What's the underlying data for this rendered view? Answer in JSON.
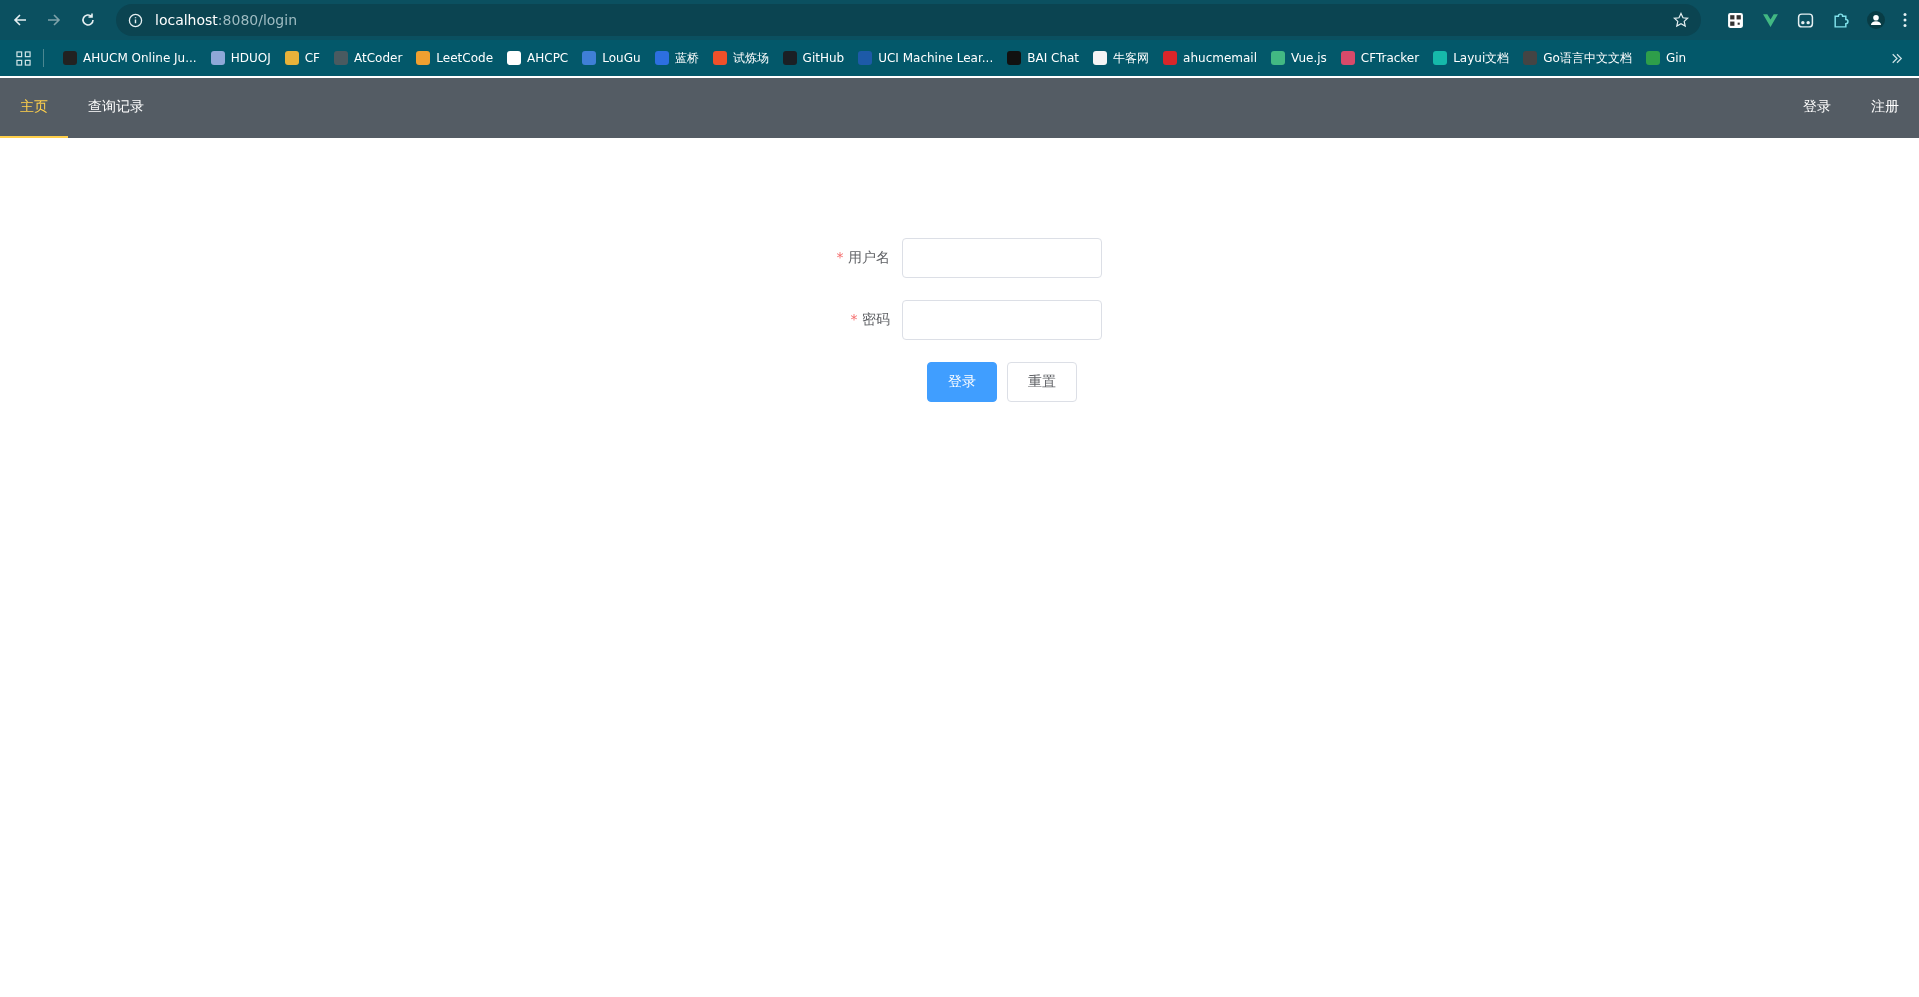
{
  "browser": {
    "address": {
      "host": "localhost",
      "path": ":8080/login"
    },
    "bookmarks": [
      {
        "label": "AHUCM Online Ju...",
        "color": "#222222"
      },
      {
        "label": "HDUOJ",
        "color": "#8fa8d8"
      },
      {
        "label": "CF",
        "color": "#e8b23a"
      },
      {
        "label": "AtCoder",
        "color": "#4a5a60"
      },
      {
        "label": "LeetCode",
        "color": "#f0a030"
      },
      {
        "label": "AHCPC",
        "color": "#ffffff"
      },
      {
        "label": "LouGu",
        "color": "#3f7fd6"
      },
      {
        "label": "蓝桥",
        "color": "#2d6fe0"
      },
      {
        "label": "试炼场",
        "color": "#f0502a"
      },
      {
        "label": "GitHub",
        "color": "#1b1f24"
      },
      {
        "label": "UCI Machine Lear...",
        "color": "#1d5aa8"
      },
      {
        "label": "BAI Chat",
        "color": "#111111"
      },
      {
        "label": "牛客网",
        "color": "#f5f5f5"
      },
      {
        "label": "ahucmemail",
        "color": "#d8262a"
      },
      {
        "label": "Vue.js",
        "color": "#42b883"
      },
      {
        "label": "CFTracker",
        "color": "#d84a6a"
      },
      {
        "label": "Layui文档",
        "color": "#16baaa"
      },
      {
        "label": "Go语言中文文档",
        "color": "#444444"
      },
      {
        "label": "Gin",
        "color": "#2e9e4a"
      }
    ]
  },
  "nav": {
    "tabs": [
      {
        "label": "主页",
        "selected": true
      },
      {
        "label": "查询记录",
        "selected": false
      }
    ],
    "links": [
      "登录",
      "注册"
    ]
  },
  "form": {
    "fields": [
      {
        "marker": "*",
        "label": "用户名"
      },
      {
        "marker": "*",
        "label": "密码"
      }
    ],
    "buttons": [
      {
        "label": "登录",
        "kind": "primary"
      },
      {
        "label": "重置",
        "kind": "default"
      }
    ]
  }
}
